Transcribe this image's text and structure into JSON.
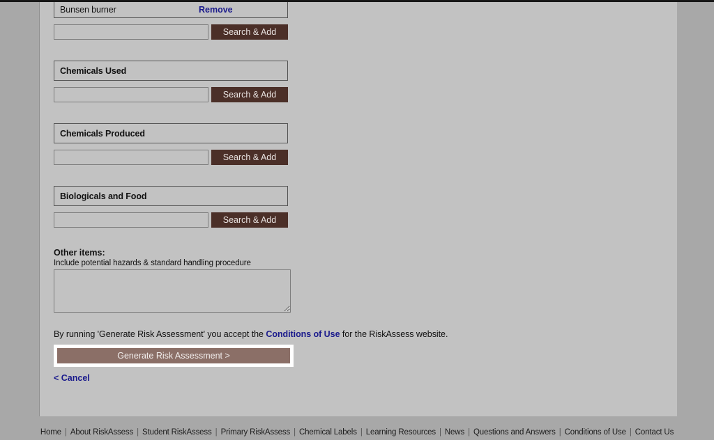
{
  "page": {
    "background_outer": "#a8a8a8",
    "background_content": "#c2c2c2",
    "accent_dark_brown": "#4b2f28",
    "accent_mauve": "#8b6f67",
    "link_navy": "#1a1a8c"
  },
  "selected_items": [
    {
      "label": "Bunsen burner",
      "remove_label": "Remove"
    }
  ],
  "equipment_search": {
    "value": "",
    "placeholder": "",
    "button_label": "Search & Add"
  },
  "sections": [
    {
      "title": "Chemicals Used",
      "search": {
        "value": "",
        "placeholder": "",
        "button_label": "Search & Add"
      }
    },
    {
      "title": "Chemicals Produced",
      "search": {
        "value": "",
        "placeholder": "",
        "button_label": "Search & Add"
      }
    },
    {
      "title": "Biologicals and Food",
      "search": {
        "value": "",
        "placeholder": "",
        "button_label": "Search & Add"
      }
    }
  ],
  "other_items": {
    "title": "Other items:",
    "subtitle": "Include potential hazards & standard handling procedure",
    "value": "",
    "placeholder": ""
  },
  "conditions": {
    "text_before": "By running 'Generate Risk Assessment' you accept the ",
    "link_label": "Conditions of Use",
    "text_after": " for the RiskAssess website."
  },
  "actions": {
    "generate_label": "Generate Risk Assessment  >",
    "cancel_label": "< Cancel"
  },
  "footer": {
    "links": [
      "Home",
      "About RiskAssess",
      "Student RiskAssess",
      "Primary RiskAssess",
      "Chemical Labels",
      "Learning Resources",
      "News",
      "Questions and Answers",
      "Conditions of Use",
      "Contact Us"
    ],
    "separator": "|"
  }
}
